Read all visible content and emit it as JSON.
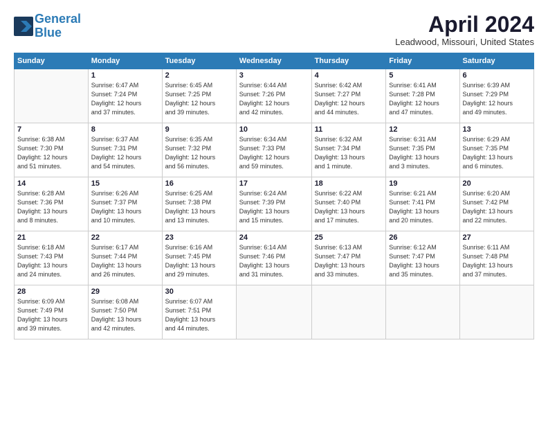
{
  "header": {
    "logo_line1": "General",
    "logo_line2": "Blue",
    "month": "April 2024",
    "location": "Leadwood, Missouri, United States"
  },
  "weekdays": [
    "Sunday",
    "Monday",
    "Tuesday",
    "Wednesday",
    "Thursday",
    "Friday",
    "Saturday"
  ],
  "weeks": [
    [
      {
        "day": "",
        "text": ""
      },
      {
        "day": "1",
        "text": "Sunrise: 6:47 AM\nSunset: 7:24 PM\nDaylight: 12 hours\nand 37 minutes."
      },
      {
        "day": "2",
        "text": "Sunrise: 6:45 AM\nSunset: 7:25 PM\nDaylight: 12 hours\nand 39 minutes."
      },
      {
        "day": "3",
        "text": "Sunrise: 6:44 AM\nSunset: 7:26 PM\nDaylight: 12 hours\nand 42 minutes."
      },
      {
        "day": "4",
        "text": "Sunrise: 6:42 AM\nSunset: 7:27 PM\nDaylight: 12 hours\nand 44 minutes."
      },
      {
        "day": "5",
        "text": "Sunrise: 6:41 AM\nSunset: 7:28 PM\nDaylight: 12 hours\nand 47 minutes."
      },
      {
        "day": "6",
        "text": "Sunrise: 6:39 AM\nSunset: 7:29 PM\nDaylight: 12 hours\nand 49 minutes."
      }
    ],
    [
      {
        "day": "7",
        "text": "Sunrise: 6:38 AM\nSunset: 7:30 PM\nDaylight: 12 hours\nand 51 minutes."
      },
      {
        "day": "8",
        "text": "Sunrise: 6:37 AM\nSunset: 7:31 PM\nDaylight: 12 hours\nand 54 minutes."
      },
      {
        "day": "9",
        "text": "Sunrise: 6:35 AM\nSunset: 7:32 PM\nDaylight: 12 hours\nand 56 minutes."
      },
      {
        "day": "10",
        "text": "Sunrise: 6:34 AM\nSunset: 7:33 PM\nDaylight: 12 hours\nand 59 minutes."
      },
      {
        "day": "11",
        "text": "Sunrise: 6:32 AM\nSunset: 7:34 PM\nDaylight: 13 hours\nand 1 minute."
      },
      {
        "day": "12",
        "text": "Sunrise: 6:31 AM\nSunset: 7:35 PM\nDaylight: 13 hours\nand 3 minutes."
      },
      {
        "day": "13",
        "text": "Sunrise: 6:29 AM\nSunset: 7:35 PM\nDaylight: 13 hours\nand 6 minutes."
      }
    ],
    [
      {
        "day": "14",
        "text": "Sunrise: 6:28 AM\nSunset: 7:36 PM\nDaylight: 13 hours\nand 8 minutes."
      },
      {
        "day": "15",
        "text": "Sunrise: 6:26 AM\nSunset: 7:37 PM\nDaylight: 13 hours\nand 10 minutes."
      },
      {
        "day": "16",
        "text": "Sunrise: 6:25 AM\nSunset: 7:38 PM\nDaylight: 13 hours\nand 13 minutes."
      },
      {
        "day": "17",
        "text": "Sunrise: 6:24 AM\nSunset: 7:39 PM\nDaylight: 13 hours\nand 15 minutes."
      },
      {
        "day": "18",
        "text": "Sunrise: 6:22 AM\nSunset: 7:40 PM\nDaylight: 13 hours\nand 17 minutes."
      },
      {
        "day": "19",
        "text": "Sunrise: 6:21 AM\nSunset: 7:41 PM\nDaylight: 13 hours\nand 20 minutes."
      },
      {
        "day": "20",
        "text": "Sunrise: 6:20 AM\nSunset: 7:42 PM\nDaylight: 13 hours\nand 22 minutes."
      }
    ],
    [
      {
        "day": "21",
        "text": "Sunrise: 6:18 AM\nSunset: 7:43 PM\nDaylight: 13 hours\nand 24 minutes."
      },
      {
        "day": "22",
        "text": "Sunrise: 6:17 AM\nSunset: 7:44 PM\nDaylight: 13 hours\nand 26 minutes."
      },
      {
        "day": "23",
        "text": "Sunrise: 6:16 AM\nSunset: 7:45 PM\nDaylight: 13 hours\nand 29 minutes."
      },
      {
        "day": "24",
        "text": "Sunrise: 6:14 AM\nSunset: 7:46 PM\nDaylight: 13 hours\nand 31 minutes."
      },
      {
        "day": "25",
        "text": "Sunrise: 6:13 AM\nSunset: 7:47 PM\nDaylight: 13 hours\nand 33 minutes."
      },
      {
        "day": "26",
        "text": "Sunrise: 6:12 AM\nSunset: 7:47 PM\nDaylight: 13 hours\nand 35 minutes."
      },
      {
        "day": "27",
        "text": "Sunrise: 6:11 AM\nSunset: 7:48 PM\nDaylight: 13 hours\nand 37 minutes."
      }
    ],
    [
      {
        "day": "28",
        "text": "Sunrise: 6:09 AM\nSunset: 7:49 PM\nDaylight: 13 hours\nand 39 minutes."
      },
      {
        "day": "29",
        "text": "Sunrise: 6:08 AM\nSunset: 7:50 PM\nDaylight: 13 hours\nand 42 minutes."
      },
      {
        "day": "30",
        "text": "Sunrise: 6:07 AM\nSunset: 7:51 PM\nDaylight: 13 hours\nand 44 minutes."
      },
      {
        "day": "",
        "text": ""
      },
      {
        "day": "",
        "text": ""
      },
      {
        "day": "",
        "text": ""
      },
      {
        "day": "",
        "text": ""
      }
    ]
  ]
}
